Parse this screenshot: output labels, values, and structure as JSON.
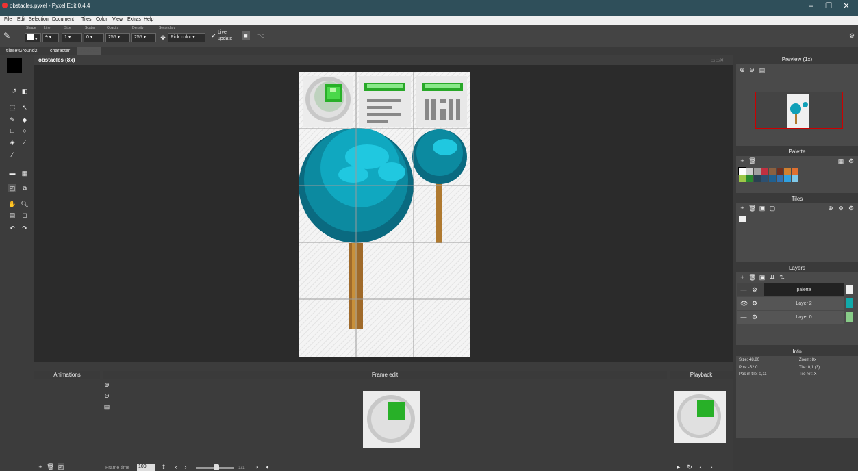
{
  "window": {
    "title": "obstacles.pyxel - Pyxel Edit 0.4.4",
    "minimize": "–",
    "maximize": "❐",
    "close": "✕"
  },
  "menu": [
    "File",
    "Edit",
    "Selection",
    "Document",
    "Tiles",
    "Color",
    "View",
    "Extras",
    "Help"
  ],
  "toolbar": {
    "labels": {
      "shape": "Shape",
      "line": "Line",
      "size": "Size",
      "scatter": "Scatter",
      "opacity": "Opacity",
      "density": "Density",
      "secondary": "Secondary"
    },
    "size": "1",
    "scatter": "0",
    "opacity": "255",
    "density": "255",
    "secondary": "Pick color",
    "live_update": "Live update"
  },
  "tabs": [
    "tilesetGround2",
    "character",
    "obstacles"
  ],
  "canvas": {
    "title": "obstacles  (8x)"
  },
  "panels": {
    "preview": "Preview (1x)",
    "palette": "Palette",
    "tiles": "Tiles",
    "layers": "Layers",
    "info": "Info",
    "animations": "Animations",
    "frame_edit": "Frame edit",
    "playback": "Playback"
  },
  "layers": [
    {
      "name": "palette",
      "visible": false
    },
    {
      "name": "Layer 2",
      "visible": true
    },
    {
      "name": "Layer 0",
      "visible": false
    }
  ],
  "palette_colors": [
    "#ffffff",
    "#d0d0d0",
    "#a0a0a0",
    "#c03040",
    "#8a6040",
    "#703020",
    "#d08030",
    "#e07030",
    "#9ec848",
    "#2a8a30",
    "#2a4050",
    "#2d5070",
    "#206090",
    "#3070b0",
    "#30a0e0",
    "#80c8e8"
  ],
  "info": {
    "size": "Size: 48,80",
    "zoom": "Zoom: 8x",
    "pos": "Pos: -52,0",
    "tile": "Tile: 0,1 (3)",
    "pos_in_tile": "Pos in tile: 0,11",
    "tile_ref": "Tile ref: X"
  },
  "frame": {
    "time_label": "Frame time",
    "time_value": "100",
    "counter": "1/1"
  }
}
